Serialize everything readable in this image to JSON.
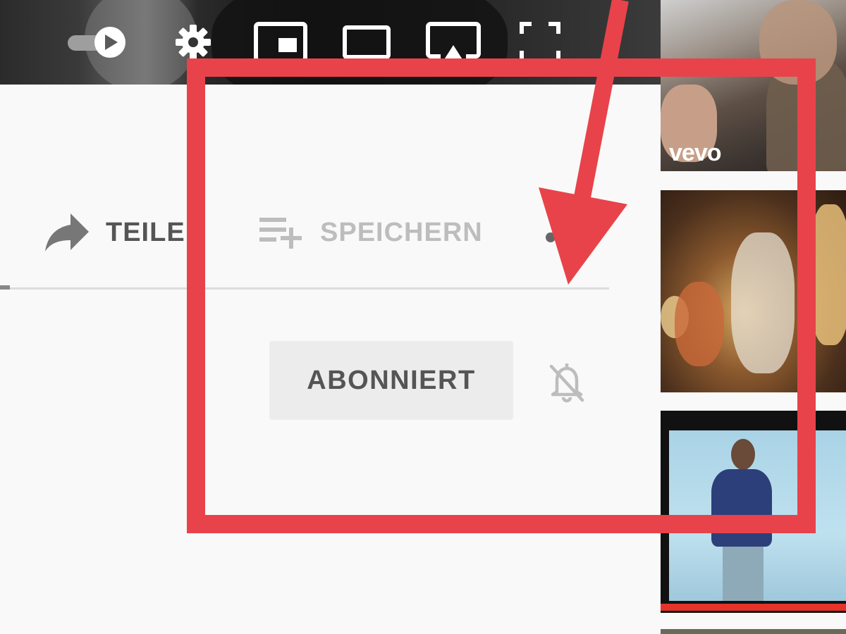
{
  "player": {
    "controls": [
      {
        "name": "autoplay-toggle"
      },
      {
        "name": "settings"
      },
      {
        "name": "miniplayer"
      },
      {
        "name": "theater-mode"
      },
      {
        "name": "cast"
      },
      {
        "name": "fullscreen"
      }
    ]
  },
  "actions": {
    "share_label": "TEILEN",
    "save_label": "SPEICHERN"
  },
  "channel": {
    "subscribe_label": "ABONNIERT",
    "notification_icon": "bell-off-icon"
  },
  "recommendations": [
    {
      "badge": "vevo"
    },
    {
      "badge": ""
    },
    {
      "badge": ""
    }
  ],
  "annotation": {
    "color": "#e8434a"
  },
  "colors": {
    "background": "#f9f9f9",
    "button_bg": "#ececec",
    "text_dark": "#555555",
    "text_muted": "#bdbdbd",
    "progress_red": "#e5332a"
  }
}
